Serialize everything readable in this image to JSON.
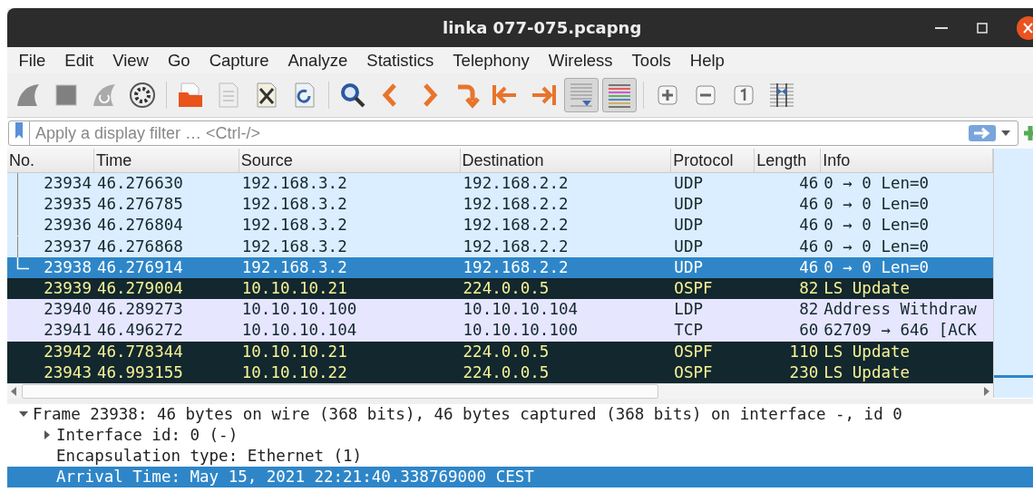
{
  "window": {
    "title": "linka 077-075.pcapng"
  },
  "menu": [
    "File",
    "Edit",
    "View",
    "Go",
    "Capture",
    "Analyze",
    "Statistics",
    "Telephony",
    "Wireless",
    "Tools",
    "Help"
  ],
  "toolbar": [
    {
      "kind": "start"
    },
    {
      "kind": "stop"
    },
    {
      "kind": "restart"
    },
    {
      "kind": "options"
    },
    {
      "kind": "separator"
    },
    {
      "kind": "open"
    },
    {
      "kind": "save"
    },
    {
      "kind": "close"
    },
    {
      "kind": "reload"
    },
    {
      "kind": "separator"
    },
    {
      "kind": "find"
    },
    {
      "kind": "back"
    },
    {
      "kind": "forward"
    },
    {
      "kind": "goto"
    },
    {
      "kind": "first"
    },
    {
      "kind": "last"
    },
    {
      "kind": "autoscroll",
      "pressed": true
    },
    {
      "kind": "colorize",
      "pressed": true
    },
    {
      "kind": "separator"
    },
    {
      "kind": "zoomin"
    },
    {
      "kind": "zoomout"
    },
    {
      "kind": "zoomreset"
    },
    {
      "kind": "resize"
    }
  ],
  "filter": {
    "placeholder": "Apply a display filter … <Ctrl-/>"
  },
  "table": {
    "columns": [
      "No.",
      "Time",
      "Source",
      "Destination",
      "Protocol",
      "Length",
      "Info"
    ],
    "rows": [
      {
        "cells": [
          "23934",
          "46.276630",
          "192.168.3.2",
          "192.168.2.2",
          "UDP",
          "46",
          "0 → 0 Len=0"
        ],
        "kind": "udp",
        "related": true,
        "selected": false
      },
      {
        "cells": [
          "23935",
          "46.276785",
          "192.168.3.2",
          "192.168.2.2",
          "UDP",
          "46",
          "0 → 0 Len=0"
        ],
        "kind": "udp",
        "related": true,
        "selected": false
      },
      {
        "cells": [
          "23936",
          "46.276804",
          "192.168.3.2",
          "192.168.2.2",
          "UDP",
          "46",
          "0 → 0 Len=0"
        ],
        "kind": "udp",
        "related": true,
        "selected": false
      },
      {
        "cells": [
          "23937",
          "46.276868",
          "192.168.3.2",
          "192.168.2.2",
          "UDP",
          "46",
          "0 → 0 Len=0"
        ],
        "kind": "udp",
        "related": true,
        "selected": false
      },
      {
        "cells": [
          "23938",
          "46.276914",
          "192.168.3.2",
          "192.168.2.2",
          "UDP",
          "46",
          "0 → 0 Len=0"
        ],
        "related": true,
        "selected": true
      },
      {
        "cells": [
          "23939",
          "46.279004",
          "10.10.10.21",
          "224.0.0.5",
          "OSPF",
          "82",
          "LS Update"
        ],
        "kind": "ospf",
        "selected": false
      },
      {
        "cells": [
          "23940",
          "46.289273",
          "10.10.10.100",
          "10.10.10.104",
          "LDP",
          "82",
          "Address Withdraw"
        ],
        "kind": "tcp",
        "selected": false
      },
      {
        "cells": [
          "23941",
          "46.496272",
          "10.10.10.104",
          "10.10.10.100",
          "TCP",
          "60",
          "62709 → 646 [ACK"
        ],
        "kind": "tcp",
        "selected": false
      },
      {
        "cells": [
          "23942",
          "46.778344",
          "10.10.10.21",
          "224.0.0.5",
          "OSPF",
          "110",
          "LS Update"
        ],
        "kind": "ospf",
        "selected": false
      },
      {
        "cells": [
          "23943",
          "46.993155",
          "10.10.10.22",
          "224.0.0.5",
          "OSPF",
          "230",
          "LS Update"
        ],
        "kind": "ospf",
        "selected": false
      }
    ]
  },
  "details": [
    {
      "text": "Frame 23938: 46 bytes on wire (368 bits), 46 bytes captured (368 bits) on interface -, id 0",
      "expanded": true,
      "selected": false,
      "children": [
        {
          "text": "Interface id: 0 (-)",
          "expanded": false,
          "selected": false
        },
        {
          "text": "Encapsulation type: Ethernet (1)",
          "selected": false
        },
        {
          "text": "Arrival Time: May 15, 2021 22:21:40.338769000 CEST",
          "selected": true
        }
      ]
    }
  ]
}
